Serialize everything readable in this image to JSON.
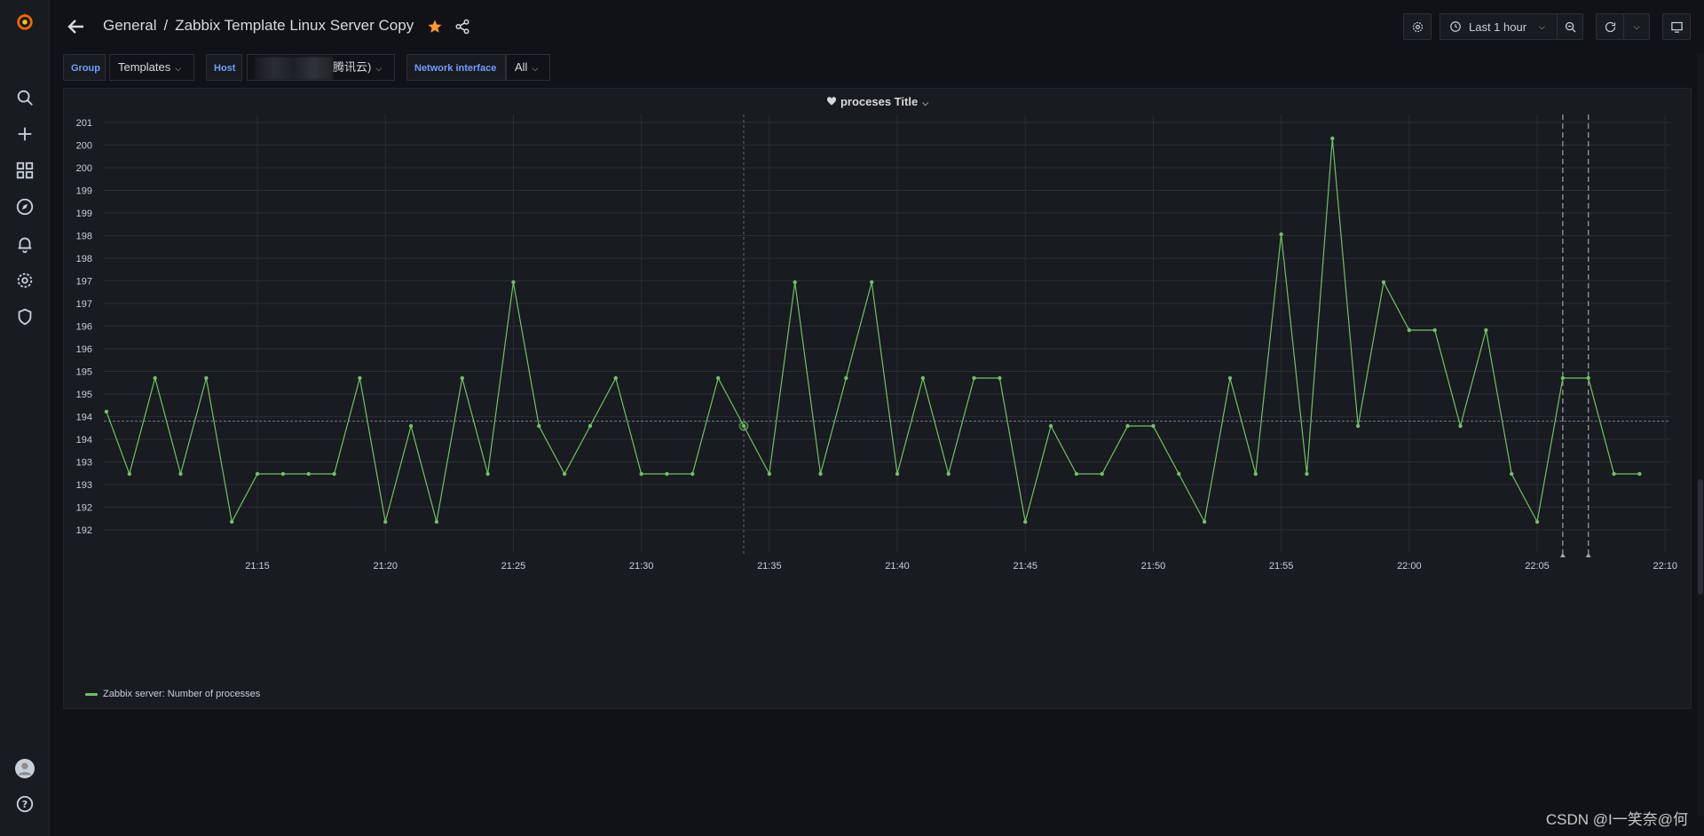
{
  "breadcrumb": {
    "folder": "General",
    "separator": "/",
    "dashboard": "Zabbix Template Linux Server Copy"
  },
  "toolbar": {
    "time_range": "Last 1 hour"
  },
  "variables": [
    {
      "label": "Group",
      "value": "Templates"
    },
    {
      "label": "Host",
      "value": "腾讯云)"
    },
    {
      "label": "Network interface",
      "value": "All"
    }
  ],
  "panel": {
    "title": "proceses Title",
    "legend": "Zabbix server: Number of processes"
  },
  "colors": {
    "series": "#73bf69",
    "accent": "#6e9fff",
    "star": "#ff9830",
    "background": "#111217"
  },
  "chart_data": {
    "type": "line",
    "y_tick_labels": [
      "192",
      "192",
      "193",
      "193",
      "194",
      "194",
      "195",
      "195",
      "196",
      "196",
      "197",
      "197",
      "198",
      "198",
      "199",
      "199",
      "200",
      "200",
      "201"
    ],
    "ylim": [
      191.5,
      200.5
    ],
    "x_tick_labels": [
      "21:15",
      "21:20",
      "21:25",
      "21:30",
      "21:35",
      "21:40",
      "21:45",
      "21:50",
      "21:55",
      "22:00",
      "22:05",
      "22:10"
    ],
    "x_tick_minutes": [
      15,
      20,
      25,
      30,
      35,
      40,
      45,
      50,
      55,
      60,
      65,
      70
    ],
    "xlim": [
      9.0,
      70.2
    ],
    "series": [
      {
        "name": "Zabbix server: Number of processes",
        "x": [
          9.1,
          10,
          11,
          12,
          13,
          14,
          15,
          16,
          17,
          18,
          19,
          20,
          21,
          22,
          23,
          24,
          25,
          26,
          27,
          28,
          29,
          30,
          31,
          32,
          33,
          34,
          35,
          36,
          37,
          38,
          39,
          40,
          41,
          42,
          43,
          44,
          45,
          46,
          47,
          48,
          49,
          50,
          51,
          52,
          53,
          54,
          55,
          56,
          57,
          58,
          59,
          60,
          61,
          62,
          63,
          64,
          65,
          66,
          67,
          68,
          69
        ],
        "y": [
          194.3,
          193,
          195,
          193,
          195,
          192,
          193,
          193,
          193,
          193,
          195,
          192,
          194,
          192,
          195,
          193,
          197,
          194,
          193,
          194,
          195,
          193,
          193,
          193,
          195,
          194,
          193,
          197,
          193,
          195,
          197,
          193,
          195,
          193,
          195,
          195,
          192,
          194,
          193,
          193,
          194,
          194,
          193,
          192,
          195,
          193,
          198,
          193,
          200,
          194,
          197,
          196,
          196,
          194,
          196,
          193,
          192,
          195,
          195,
          193,
          193
        ]
      }
    ],
    "reference_line": 194.1,
    "annotations_x": [
      34,
      66,
      67
    ]
  }
}
